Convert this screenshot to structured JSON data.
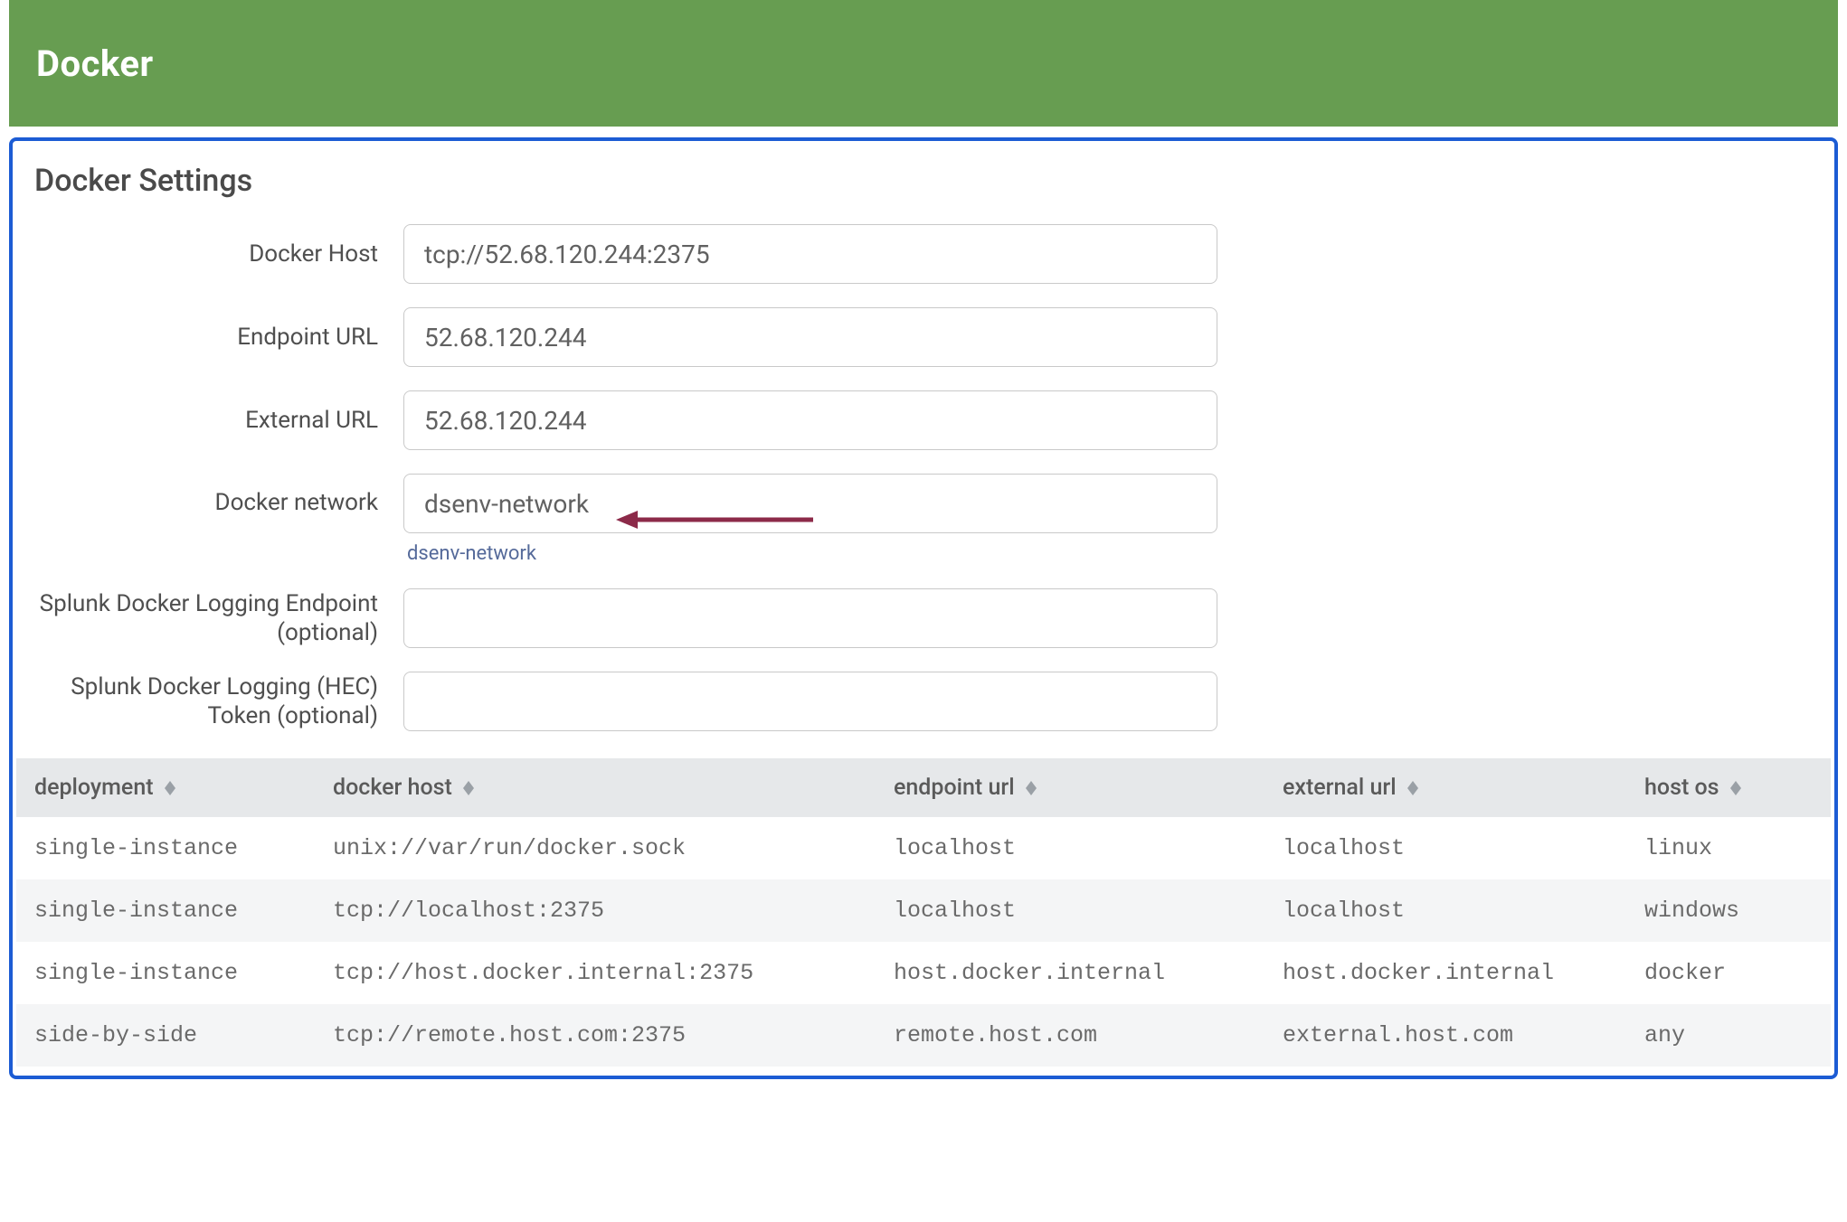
{
  "header": {
    "title": "Docker"
  },
  "panel": {
    "title": "Docker Settings"
  },
  "form": {
    "docker_host": {
      "label": "Docker Host",
      "value": "tcp://52.68.120.244:2375"
    },
    "endpoint_url": {
      "label": "Endpoint URL",
      "value": "52.68.120.244"
    },
    "external_url": {
      "label": "External URL",
      "value": "52.68.120.244"
    },
    "docker_network": {
      "label": "Docker network",
      "value": "dsenv-network",
      "hint": "dsenv-network"
    },
    "splunk_endpoint": {
      "label": "Splunk Docker Logging Endpoint (optional)",
      "value": ""
    },
    "splunk_token": {
      "label": "Splunk Docker Logging (HEC) Token (optional)",
      "value": ""
    }
  },
  "table": {
    "columns": {
      "deployment": "deployment",
      "docker_host": "docker host",
      "endpoint": "endpoint url",
      "external": "external url",
      "host_os": "host os"
    },
    "rows": [
      {
        "deployment": "single-instance",
        "docker_host": "unix://var/run/docker.sock",
        "endpoint": "localhost",
        "external": "localhost",
        "host_os": "linux"
      },
      {
        "deployment": "single-instance",
        "docker_host": "tcp://localhost:2375",
        "endpoint": "localhost",
        "external": "localhost",
        "host_os": "windows"
      },
      {
        "deployment": "single-instance",
        "docker_host": "tcp://host.docker.internal:2375",
        "endpoint": "host.docker.internal",
        "external": "host.docker.internal",
        "host_os": "docker"
      },
      {
        "deployment": "side-by-side",
        "docker_host": "tcp://remote.host.com:2375",
        "endpoint": "remote.host.com",
        "external": "external.host.com",
        "host_os": "any"
      }
    ]
  },
  "colors": {
    "header_bg": "#679D51",
    "panel_border": "#1c5cd4",
    "annotation_arrow": "#8c2a49"
  }
}
